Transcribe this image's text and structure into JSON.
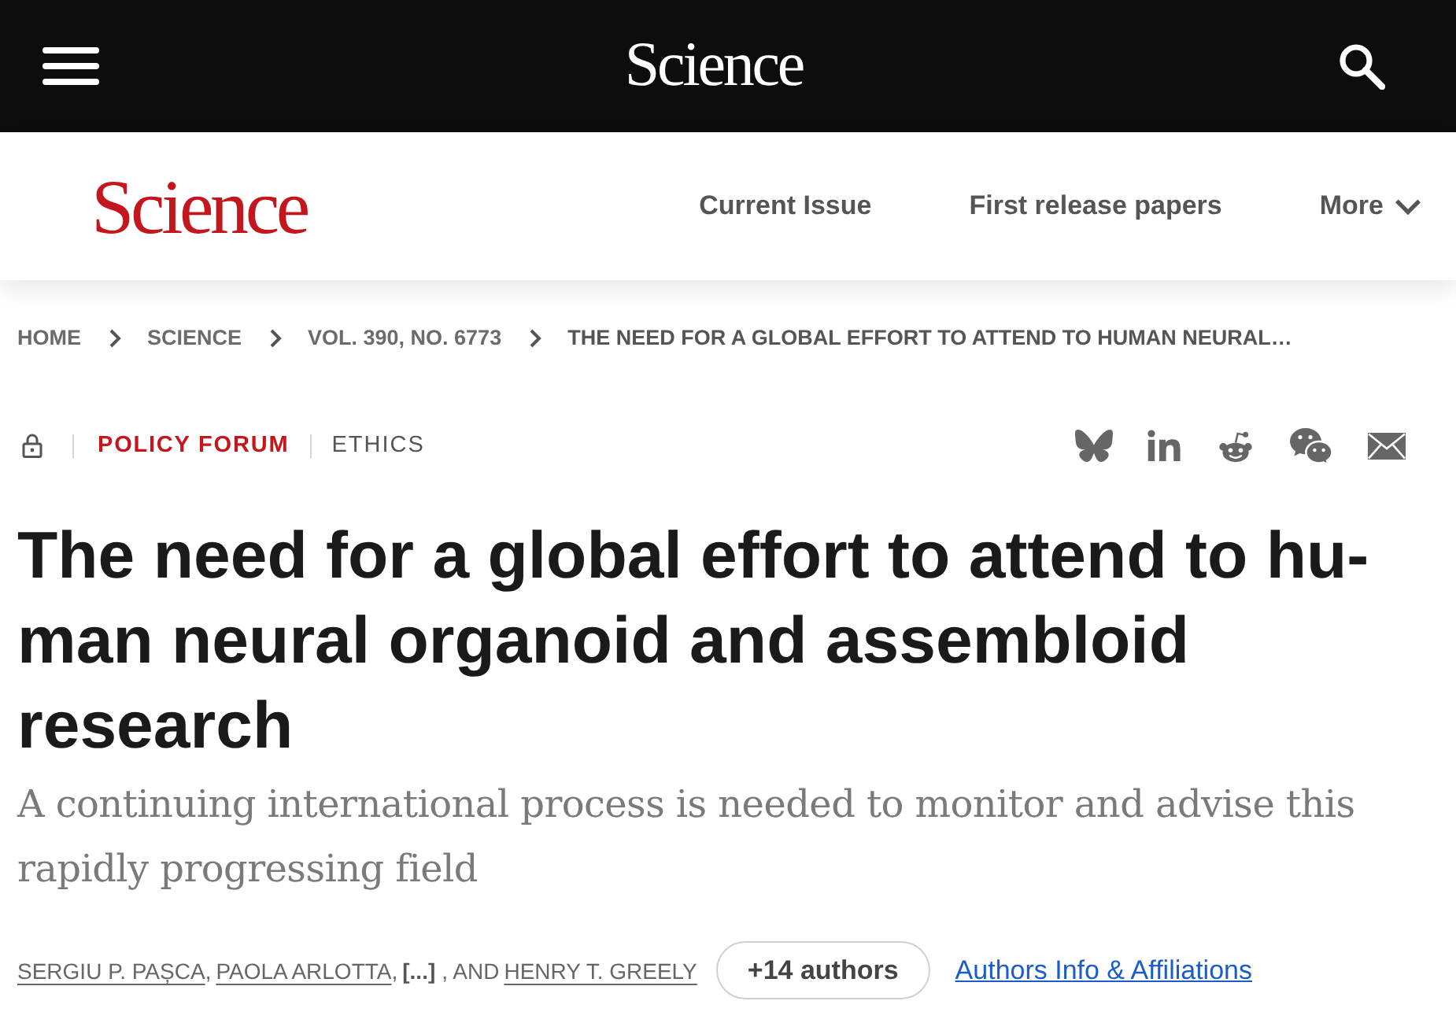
{
  "top_bar": {
    "logo": "Science"
  },
  "site_header": {
    "logo": "Science",
    "nav": [
      {
        "label": "Current Issue",
        "kind": "link"
      },
      {
        "label": "First release papers",
        "kind": "link"
      },
      {
        "label": "More",
        "kind": "dropdown"
      }
    ]
  },
  "breadcrumb": [
    "HOME",
    "SCIENCE",
    "VOL. 390, NO. 6773",
    "THE NEED FOR A GLOBAL EFFORT TO ATTEND TO HUMAN NEURAL…"
  ],
  "article_meta": {
    "section": "POLICY FORUM",
    "topic": "ETHICS"
  },
  "title": "The need for a global effort to attend to hu-man neural organoid and assembloid research",
  "subtitle": "A continuing international process is needed to monitor and advise this rapidly progressing field",
  "authors": {
    "byline": [
      {
        "kind": "name",
        "text": "SERGIU P. PAȘCA",
        "after": ","
      },
      {
        "kind": "name",
        "text": "PAOLA ARLOTTA",
        "after": ","
      },
      {
        "kind": "more",
        "text": "[...]",
        "after": ", AND"
      },
      {
        "kind": "name",
        "text": "HENRY T. GREELY"
      }
    ],
    "more_button": "+14 authors",
    "affiliations_link": "Authors Info & Affiliations"
  }
}
